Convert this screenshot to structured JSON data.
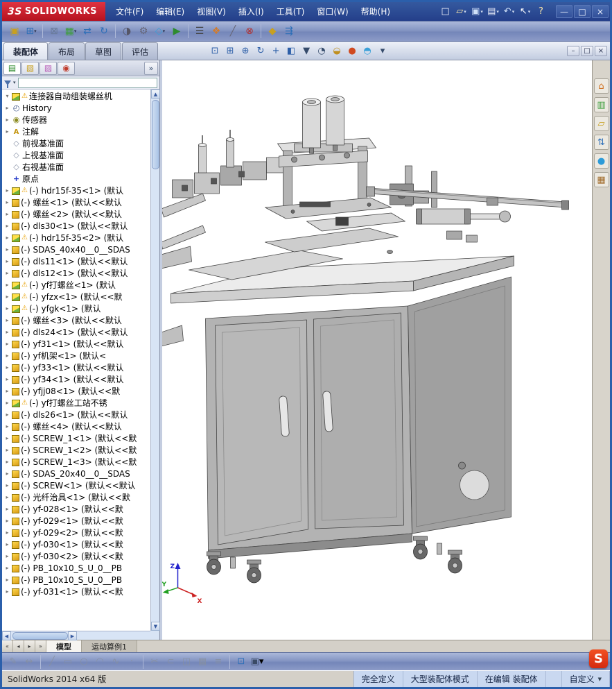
{
  "titlebar": {
    "brand_prefix": "3S",
    "brand": "SOLIDWORKS",
    "menus": [
      "文件(F)",
      "编辑(E)",
      "视图(V)",
      "插入(I)",
      "工具(T)",
      "窗口(W)",
      "帮助(H)"
    ],
    "qat": [
      {
        "name": "new-document-button",
        "glyph": "□",
        "color": "#f0f4fc"
      },
      {
        "name": "open-document-button",
        "glyph": "▱",
        "color": "#ffe9a8",
        "dd": "▾"
      },
      {
        "name": "save-button",
        "glyph": "▣",
        "color": "#cfe0f8",
        "dd": "▾"
      },
      {
        "name": "print-button",
        "glyph": "▤",
        "color": "#e8ecf8",
        "dd": "▾"
      },
      {
        "name": "undo-button",
        "glyph": "↶",
        "color": "#cfe0f8",
        "dd": "▾"
      },
      {
        "name": "select-tool-button",
        "glyph": "↖",
        "color": "#ffffff",
        "dd": "▾"
      },
      {
        "name": "help-button",
        "glyph": "?",
        "color": "#ffe9a8"
      }
    ],
    "window_buttons": [
      {
        "name": "minimize-button",
        "glyph": "—"
      },
      {
        "name": "maximize-button",
        "glyph": "□"
      },
      {
        "name": "close-button",
        "glyph": "×"
      }
    ]
  },
  "toolbar": {
    "icons": [
      {
        "name": "insert-components-button",
        "glyph": "▣",
        "color": "#c8a020"
      },
      {
        "name": "mate-button",
        "glyph": "⊞",
        "color": "#2d6fb8",
        "dd": "▾"
      },
      {
        "sep": true
      },
      {
        "name": "smart-fasteners-button",
        "glyph": "⊠",
        "color": "#6a7a99"
      },
      {
        "name": "linear-component-pattern-button",
        "glyph": "▦",
        "color": "#3f9e3f",
        "dd": "▾"
      },
      {
        "name": "move-component-button",
        "glyph": "⇄",
        "color": "#2d6fb8"
      },
      {
        "name": "rotate-component-button",
        "glyph": "↻",
        "color": "#2d6fb8"
      },
      {
        "sep": true
      },
      {
        "name": "show-hidden-components-button",
        "glyph": "◑",
        "color": "#556"
      },
      {
        "name": "assembly-features-button",
        "glyph": "⚙",
        "color": "#667"
      },
      {
        "name": "reference-geometry-button",
        "glyph": "◇",
        "color": "#3aa0d8",
        "dd": "▾"
      },
      {
        "name": "new-motion-study-button",
        "glyph": "▶",
        "color": "#2e8b2e"
      },
      {
        "sep": true
      },
      {
        "name": "bill-of-materials-button",
        "glyph": "☰",
        "color": "#444"
      },
      {
        "name": "exploded-view-button",
        "glyph": "❖",
        "color": "#d27b2c"
      },
      {
        "name": "explode-line-sketch-button",
        "glyph": "╱",
        "color": "#667"
      },
      {
        "name": "interference-detection-button",
        "glyph": "⊗",
        "color": "#b03030"
      },
      {
        "sep": true
      },
      {
        "name": "instant3d-button",
        "glyph": "◆",
        "color": "#c8a020"
      },
      {
        "name": "external-references-button",
        "glyph": "⇶",
        "color": "#2d6fb8"
      }
    ]
  },
  "tab_row": {
    "tabs": [
      {
        "label": "装配体",
        "active": true
      },
      {
        "label": "布局"
      },
      {
        "label": "草图"
      },
      {
        "label": "评估"
      }
    ],
    "view_icons": [
      {
        "name": "zoom-fit-button",
        "glyph": "⊡",
        "color": "#2d5fa8"
      },
      {
        "name": "zoom-area-button",
        "glyph": "⊞",
        "color": "#2d5fa8"
      },
      {
        "name": "zoom-in-out-button",
        "glyph": "⊕",
        "color": "#2d5fa8"
      },
      {
        "name": "rotate-view-button",
        "glyph": "↻",
        "color": "#2d5fa8"
      },
      {
        "name": "pan-button",
        "glyph": "+",
        "color": "#2d5fa8"
      },
      {
        "name": "section-view-button",
        "glyph": "◧",
        "color": "#2d5fa8"
      },
      {
        "name": "view-orientation-button",
        "glyph": "▼",
        "color": "#344a6a"
      },
      {
        "name": "display-style-button",
        "glyph": "◔",
        "color": "#344a6a"
      },
      {
        "name": "hide-show-items-button",
        "glyph": "◒",
        "color": "#c09020"
      },
      {
        "name": "edit-appearance-button",
        "glyph": "●",
        "color": "#d04a20"
      },
      {
        "name": "apply-scene-button",
        "glyph": "◓",
        "color": "#3aa0d8"
      },
      {
        "name": "view-settings-button",
        "glyph": "▾",
        "color": "#344a6a"
      }
    ],
    "doc_buttons": [
      {
        "name": "doc-minimize-button",
        "glyph": "–"
      },
      {
        "name": "doc-restore-button",
        "glyph": "□"
      },
      {
        "name": "doc-close-button",
        "glyph": "×"
      }
    ]
  },
  "left_panel": {
    "tabs": [
      {
        "name": "featuremanager-tab",
        "glyph": "▤",
        "color": "#2e8b2e",
        "active": true
      },
      {
        "name": "propertymanager-tab",
        "glyph": "▧",
        "color": "#c8a020"
      },
      {
        "name": "configurationmanager-tab",
        "glyph": "▨",
        "color": "#b85fb8"
      },
      {
        "name": "dimxpertmanager-tab",
        "glyph": "◉",
        "color": "#c03a2a"
      },
      {
        "name": "panel-expand-button",
        "glyph": "»",
        "color": "#334a6a",
        "chev": true
      }
    ],
    "tree": {
      "items": [
        {
          "arrow": "▾",
          "icon": "assembly",
          "warn": "⚠",
          "label": "连接器自动组装螺丝机"
        },
        {
          "arrow": "▸",
          "icon": "history",
          "warn": "",
          "label": "History"
        },
        {
          "arrow": "▸",
          "icon": "sensor",
          "warn": "",
          "label": "传感器"
        },
        {
          "arrow": "▸",
          "icon": "ann",
          "warn": "",
          "label": "注解"
        },
        {
          "arrow": "",
          "icon": "plane",
          "warn": "",
          "label": "前视基准面"
        },
        {
          "arrow": "",
          "icon": "plane",
          "warn": "",
          "label": "上视基准面"
        },
        {
          "arrow": "",
          "icon": "plane",
          "warn": "",
          "label": "右视基准面"
        },
        {
          "arrow": "",
          "icon": "origin",
          "warn": "",
          "label": "原点"
        },
        {
          "arrow": "▸",
          "icon": "assembly",
          "warn": "⚠",
          "label": "(-) hdr15f-35<1> (默认"
        },
        {
          "arrow": "▸",
          "icon": "part",
          "warn": "",
          "label": "(-) 螺丝<1> (默认<<默认"
        },
        {
          "arrow": "▸",
          "icon": "part",
          "warn": "",
          "label": "(-) 螺丝<2> (默认<<默认"
        },
        {
          "arrow": "▸",
          "icon": "part",
          "warn": "",
          "label": "(-) dls30<1> (默认<<默认"
        },
        {
          "arrow": "▸",
          "icon": "assembly",
          "warn": "⚠",
          "label": "(-) hdr15f-35<2> (默认"
        },
        {
          "arrow": "▸",
          "icon": "part",
          "warn": "",
          "label": "(-) SDAS_40x40__0__SDAS"
        },
        {
          "arrow": "▸",
          "icon": "part",
          "warn": "",
          "label": "(-) dls11<1> (默认<<默认"
        },
        {
          "arrow": "▸",
          "icon": "part",
          "warn": "",
          "label": "(-) dls12<1> (默认<<默认"
        },
        {
          "arrow": "▸",
          "icon": "assembly",
          "warn": "⚠",
          "label": "(-) yf打螺丝<1> (默认"
        },
        {
          "arrow": "▸",
          "icon": "assembly",
          "warn": "⚠",
          "label": "(-) yfzx<1> (默认<<默"
        },
        {
          "arrow": "▸",
          "icon": "assembly",
          "warn": "⚠",
          "label": "(-) yfgk<1> (默认"
        },
        {
          "arrow": "▸",
          "icon": "part",
          "warn": "",
          "label": "(-) 螺丝<3> (默认<<默认"
        },
        {
          "arrow": "▸",
          "icon": "part",
          "warn": "",
          "label": "(-) dls24<1> (默认<<默认"
        },
        {
          "arrow": "▸",
          "icon": "part",
          "warn": "",
          "label": "(-) yf31<1> (默认<<默认"
        },
        {
          "arrow": "▸",
          "icon": "part",
          "warn": "",
          "label": "(-) yf机架<1> (默认<"
        },
        {
          "arrow": "▸",
          "icon": "part",
          "warn": "",
          "label": "(-) yf33<1> (默认<<默认"
        },
        {
          "arrow": "▸",
          "icon": "part",
          "warn": "",
          "label": "(-) yf34<1> (默认<<默认"
        },
        {
          "arrow": "▸",
          "icon": "part",
          "warn": "",
          "label": "(-) yfjj08<1> (默认<<默"
        },
        {
          "arrow": "▸",
          "icon": "assembly",
          "warn": "⚠",
          "label": "(-) yf打螺丝工站不锈"
        },
        {
          "arrow": "▸",
          "icon": "part",
          "warn": "",
          "label": "(-) dls26<1> (默认<<默认"
        },
        {
          "arrow": "▸",
          "icon": "part",
          "warn": "",
          "label": "(-) 螺丝<4> (默认<<默认"
        },
        {
          "arrow": "▸",
          "icon": "part",
          "warn": "",
          "label": "(-) SCREW_1<1> (默认<<默"
        },
        {
          "arrow": "▸",
          "icon": "part",
          "warn": "",
          "label": "(-) SCREW_1<2> (默认<<默"
        },
        {
          "arrow": "▸",
          "icon": "part",
          "warn": "",
          "label": "(-) SCREW_1<3> (默认<<默"
        },
        {
          "arrow": "▸",
          "icon": "part",
          "warn": "",
          "label": "(-) SDAS_20x40__0__SDAS"
        },
        {
          "arrow": "▸",
          "icon": "part",
          "warn": "",
          "label": "(-) SCREW<1> (默认<<默认"
        },
        {
          "arrow": "▸",
          "icon": "part",
          "warn": "",
          "label": "(-) 光纤治具<1> (默认<<默"
        },
        {
          "arrow": "▸",
          "icon": "part",
          "warn": "",
          "label": "(-) yf-028<1> (默认<<默"
        },
        {
          "arrow": "▸",
          "icon": "part",
          "warn": "",
          "label": "(-) yf-029<1> (默认<<默"
        },
        {
          "arrow": "▸",
          "icon": "part",
          "warn": "",
          "label": "(-) yf-029<2> (默认<<默"
        },
        {
          "arrow": "▸",
          "icon": "part",
          "warn": "",
          "label": "(-) yf-030<1> (默认<<默"
        },
        {
          "arrow": "▸",
          "icon": "part",
          "warn": "",
          "label": "(-) yf-030<2> (默认<<默"
        },
        {
          "arrow": "▸",
          "icon": "part",
          "warn": "",
          "label": "(-) PB_10x10_S_U_0__PB"
        },
        {
          "arrow": "▸",
          "icon": "part",
          "warn": "",
          "label": "(-) PB_10x10_S_U_0__PB"
        },
        {
          "arrow": "▸",
          "icon": "part",
          "warn": "",
          "label": "(-) yf-031<1> (默认<<默"
        }
      ]
    }
  },
  "viewport": {
    "triad": {
      "x": "X",
      "y": "Y",
      "z": "Z"
    }
  },
  "task_pane": {
    "icons": [
      {
        "name": "solidworks-resources-button",
        "glyph": "⌂",
        "color": "#d07020"
      },
      {
        "name": "design-library-button",
        "glyph": "▥",
        "color": "#3f9e3f"
      },
      {
        "name": "file-explorer-button",
        "glyph": "▱",
        "color": "#c8a020"
      },
      {
        "name": "view-palette-button",
        "glyph": "⇅",
        "color": "#2d6fb8"
      },
      {
        "name": "appearances-button",
        "glyph": "●",
        "color": "#2d9bd8"
      },
      {
        "name": "custom-properties-button",
        "glyph": "▦",
        "color": "#a06a28"
      }
    ]
  },
  "model_tabs": {
    "nav": [
      {
        "name": "tabs-scroll-first-button",
        "glyph": "«"
      },
      {
        "name": "tabs-scroll-left-button",
        "glyph": "◂"
      },
      {
        "name": "tabs-scroll-right-button",
        "glyph": "▸"
      },
      {
        "name": "tabs-scroll-last-button",
        "glyph": "»"
      }
    ],
    "tabs": [
      {
        "label": "模型",
        "active": true
      },
      {
        "label": "运动算例1"
      }
    ]
  },
  "bottom_toolbar": {
    "icons": [
      {
        "name": "sketch-button",
        "glyph": "✎",
        "color": "#88909e",
        "disabled": true
      },
      {
        "name": "smart-dimension-button",
        "glyph": "↔",
        "color": "#88909e",
        "disabled": true
      },
      {
        "sep": true
      },
      {
        "name": "line-tool-button",
        "glyph": "╱",
        "color": "#88909e",
        "disabled": true
      },
      {
        "name": "rectangle-tool-button",
        "glyph": "▭",
        "color": "#88909e",
        "disabled": true
      },
      {
        "name": "circle-tool-button",
        "glyph": "○",
        "color": "#88909e",
        "disabled": true
      },
      {
        "name": "arc-tool-button",
        "glyph": "◠",
        "color": "#88909e",
        "disabled": true
      },
      {
        "name": "spline-tool-button",
        "glyph": "∿",
        "color": "#88909e",
        "disabled": true
      },
      {
        "name": "point-tool-button",
        "glyph": "·",
        "color": "#88909e",
        "disabled": true
      },
      {
        "sep": true
      },
      {
        "name": "trim-entities-button",
        "glyph": "✂",
        "color": "#88909e",
        "disabled": true
      },
      {
        "name": "convert-entities-button",
        "glyph": "⊂",
        "color": "#88909e",
        "disabled": true
      },
      {
        "name": "mirror-entities-button",
        "glyph": "◫",
        "color": "#88909e",
        "disabled": true
      },
      {
        "name": "linear-sketch-pattern-button",
        "glyph": "▦",
        "color": "#88909e",
        "disabled": true
      },
      {
        "name": "offset-entities-button",
        "glyph": "≡",
        "color": "#88909e",
        "disabled": true
      },
      {
        "sep": true
      },
      {
        "name": "instant2d-button",
        "glyph": "⊡",
        "color": "#2d6fb8"
      },
      {
        "name": "save-options-button",
        "glyph": "▣",
        "color": "#3a4a66",
        "dd": "▾"
      }
    ]
  },
  "statusbar": {
    "left_text": "SolidWorks 2014 x64 版",
    "fields": [
      {
        "label": "完全定义"
      },
      {
        "label": "大型装配体模式"
      },
      {
        "label": "在编辑 装配体"
      },
      {
        "label": "",
        "grow": true
      },
      {
        "label": "自定义",
        "dd": "▼",
        "click": true
      }
    ]
  },
  "overlay": {
    "sogou": "S"
  }
}
